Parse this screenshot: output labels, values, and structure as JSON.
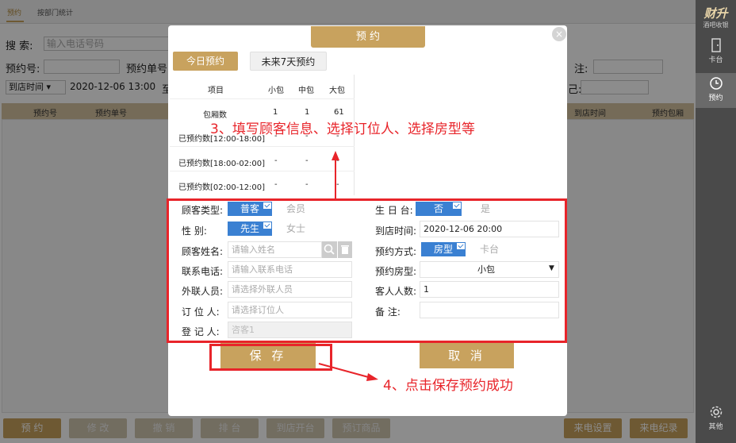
{
  "app": {
    "tabs": [
      "预约",
      "按部门统计"
    ],
    "search_label": "搜    索:",
    "search_placeholder": "输入电话号码",
    "order_no_label": "预约号:",
    "booking_no_label": "预约单号",
    "note_label": "注:",
    "time_select": "到店时间",
    "start_time": "2020-12-06 13:00",
    "to_label": "至",
    "colon_label": "己:",
    "table_headers": [
      "预约号",
      "预约单号",
      "到店时间",
      "预约包厢"
    ]
  },
  "sidebar": {
    "brand_main": "财升",
    "brand_sub": "酒吧收银",
    "items": [
      {
        "label": "卡台",
        "icon": "door-icon"
      },
      {
        "label": "预约",
        "icon": "clock-icon"
      },
      {
        "label": "其他",
        "icon": "gear-icon"
      }
    ]
  },
  "bottom_bar": {
    "buttons": [
      "预 约",
      "修 改",
      "撤 销",
      "排 台",
      "到店开台",
      "预订商品",
      "来电设置",
      "来电纪录"
    ]
  },
  "modal": {
    "title": "预 约",
    "tab_today": "今日预约",
    "tab_future": "未来7天预约",
    "stats": {
      "headers": [
        "项目",
        "小包",
        "中包",
        "大包"
      ],
      "rows": [
        [
          "包厢数",
          "1",
          "1",
          "61"
        ],
        [
          "已预约数[12:00-18:00]",
          "-",
          "-",
          "-"
        ],
        [
          "已预约数[18:00-02:00]",
          "-",
          "-",
          "-"
        ],
        [
          "已预约数[02:00-12:00]",
          "-",
          "-",
          "-"
        ]
      ]
    },
    "form": {
      "customer_type_label": "顾客类型:",
      "customer_type_options": [
        "普客",
        "会员"
      ],
      "gender_label": "性    别:",
      "gender_options": [
        "先生",
        "女士"
      ],
      "name_label": "顾客姓名:",
      "name_placeholder": "请输入姓名",
      "phone_label": "联系电话:",
      "phone_placeholder": "请输入联系电话",
      "liaison_label": "外联人员:",
      "liaison_placeholder": "请选择外联人员",
      "booker_label": "订 位 人:",
      "booker_placeholder": "请选择订位人",
      "registrar_label": "登 记 人:",
      "registrar_value": "咨客1",
      "birthday_label": "生 日 台:",
      "birthday_options": [
        "否",
        "是"
      ],
      "arrival_label": "到店时间:",
      "arrival_value": "2020-12-06 20:00",
      "method_label": "预约方式:",
      "method_options": [
        "房型",
        "卡台"
      ],
      "room_type_label": "预约房型:",
      "room_type_value": "小包",
      "guests_label": "客人人数:",
      "guests_value": "1",
      "remark_label": "备    注:"
    },
    "save_button": "保 存",
    "cancel_button": "取 消"
  },
  "annotations": {
    "step3": "3、填写顾客信息、选择订位人、选择房型等",
    "step4": "4、点击保存预约成功"
  }
}
